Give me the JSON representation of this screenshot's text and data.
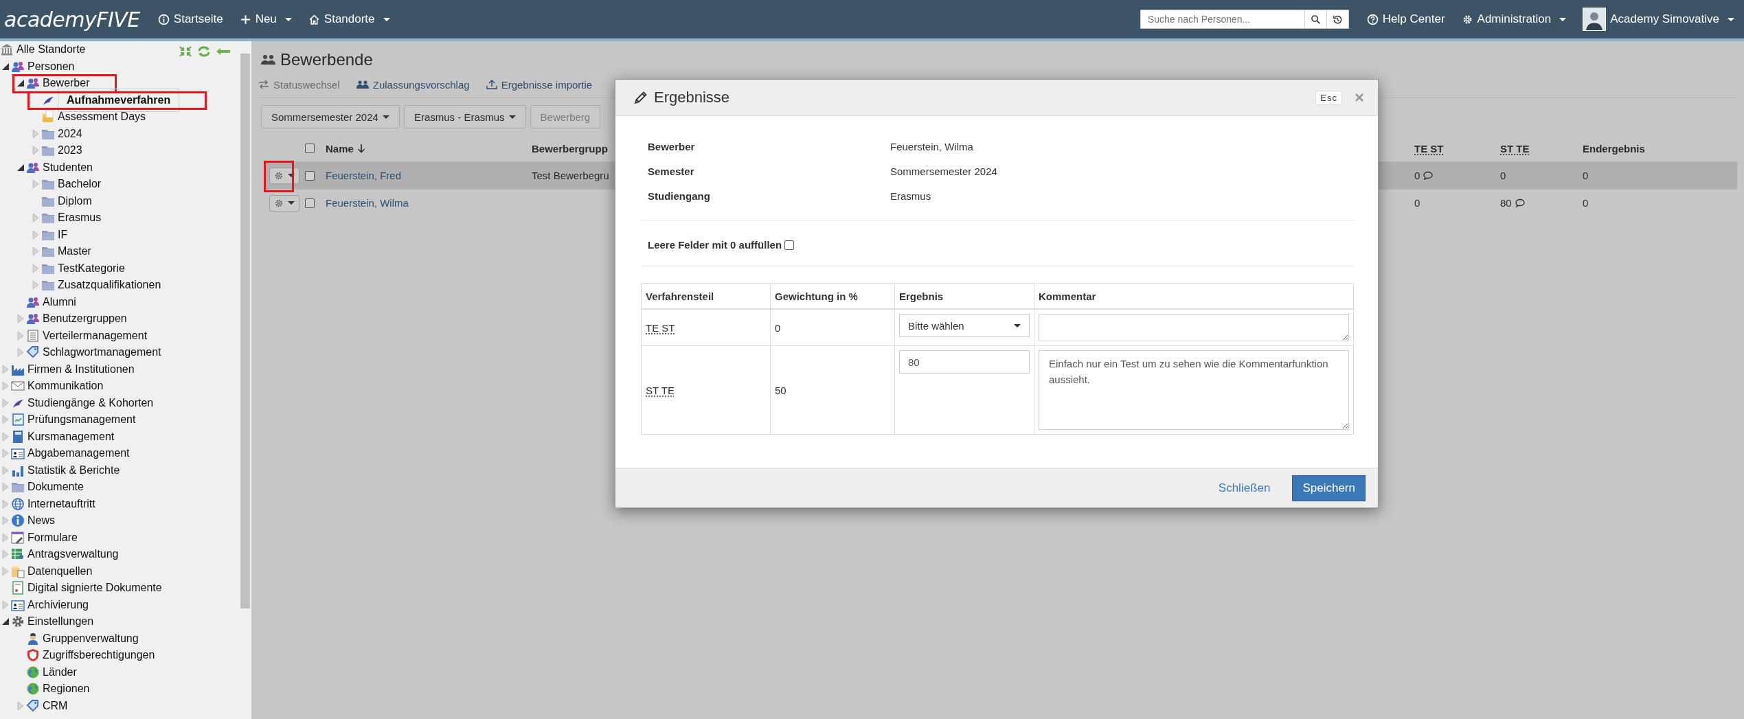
{
  "topbar": {
    "logo": "academyFIVE",
    "nav": [
      {
        "label": "Startseite",
        "kind": "link"
      },
      {
        "label": "Neu",
        "kind": "dropdown"
      },
      {
        "label": "Standorte",
        "kind": "dropdown"
      }
    ],
    "search": {
      "placeholder": "Suche nach Personen..."
    },
    "links": [
      {
        "label": "Help Center",
        "kind": "link"
      },
      {
        "label": "Administration",
        "kind": "dropdown"
      }
    ],
    "user": "Academy Simovative"
  },
  "sidebar": {
    "root": "Alle Standorte",
    "tree": [
      {
        "label": "Personen",
        "kind": "people",
        "expanded": true,
        "selected": false,
        "children": [
          {
            "label": "Bewerber",
            "kind": "people",
            "expanded": true,
            "selected": false,
            "annotated": true,
            "children": [
              {
                "label": "Aufnahmeverfahren",
                "kind": "cap",
                "selected": true,
                "annotated": true
              },
              {
                "label": "Assessment Days",
                "kind": "folder-open",
                "selected": false
              },
              {
                "label": "2024",
                "kind": "folder",
                "expanded": false,
                "selected": false
              },
              {
                "label": "2023",
                "kind": "folder",
                "expanded": false,
                "selected": false
              }
            ]
          },
          {
            "label": "Studenten",
            "kind": "people",
            "expanded": true,
            "selected": false,
            "children": [
              {
                "label": "Bachelor",
                "kind": "folder",
                "expanded": false,
                "selected": false
              },
              {
                "label": "Diplom",
                "kind": "folder",
                "selected": false
              },
              {
                "label": "Erasmus",
                "kind": "folder",
                "expanded": false,
                "selected": false
              },
              {
                "label": "IF",
                "kind": "folder",
                "expanded": false,
                "selected": false
              },
              {
                "label": "Master",
                "kind": "folder",
                "expanded": false,
                "selected": false
              },
              {
                "label": "TestKategorie",
                "kind": "folder",
                "expanded": false,
                "selected": false
              },
              {
                "label": "Zusatzqualifikationen",
                "kind": "folder",
                "expanded": false,
                "selected": false
              }
            ]
          },
          {
            "label": "Alumni",
            "kind": "people",
            "selected": false
          },
          {
            "label": "Benutzergruppen",
            "kind": "people",
            "expanded": false,
            "selected": false
          },
          {
            "label": "Verteilermanagement",
            "kind": "list",
            "expanded": false,
            "selected": false
          },
          {
            "label": "Schlagwortmanagement",
            "kind": "tag",
            "expanded": false,
            "selected": false
          }
        ]
      },
      {
        "label": "Firmen & Institutionen",
        "kind": "factory",
        "expanded": false,
        "selected": false
      },
      {
        "label": "Kommunikation",
        "kind": "mail",
        "expanded": false,
        "selected": false
      },
      {
        "label": "Studiengänge & Kohorten",
        "kind": "cap",
        "expanded": false,
        "selected": false
      },
      {
        "label": "Prüfungsmanagement",
        "kind": "notebook",
        "expanded": false,
        "selected": false
      },
      {
        "label": "Kursmanagement",
        "kind": "book",
        "expanded": false,
        "selected": false
      },
      {
        "label": "Abgabemanagement",
        "kind": "idcard",
        "expanded": false,
        "selected": false
      },
      {
        "label": "Statistik & Berichte",
        "kind": "chart",
        "expanded": false,
        "selected": false
      },
      {
        "label": "Dokumente",
        "kind": "folder",
        "expanded": false,
        "selected": false
      },
      {
        "label": "Internetauftritt",
        "kind": "globe",
        "expanded": false,
        "selected": false
      },
      {
        "label": "News",
        "kind": "info",
        "expanded": false,
        "selected": false
      },
      {
        "label": "Formulare",
        "kind": "form",
        "expanded": false,
        "selected": false
      },
      {
        "label": "Antragsverwaltung",
        "kind": "sheet",
        "expanded": false,
        "selected": false
      },
      {
        "label": "Datenquellen",
        "kind": "database",
        "expanded": false,
        "selected": false
      },
      {
        "label": "Digital signierte Dokumente",
        "kind": "certificate",
        "selected": false
      },
      {
        "label": "Archivierung",
        "kind": "idcard",
        "expanded": false,
        "selected": false
      },
      {
        "label": "Einstellungen",
        "kind": "gear",
        "expanded": true,
        "selected": false,
        "children": [
          {
            "label": "Gruppenverwaltung",
            "kind": "user",
            "selected": false
          },
          {
            "label": "Zugriffsberechtigungen",
            "kind": "shield",
            "selected": false
          },
          {
            "label": "Länder",
            "kind": "earth",
            "selected": false
          },
          {
            "label": "Regionen",
            "kind": "earth",
            "selected": false
          },
          {
            "label": "CRM",
            "kind": "tag",
            "expanded": false,
            "selected": false
          }
        ]
      }
    ]
  },
  "page": {
    "title": "Bewerbende",
    "actions": [
      {
        "label": "Statuswechsel",
        "disabled": true
      },
      {
        "label": "Zulassungsvorschlag",
        "disabled": false
      },
      {
        "label": "Ergebnisse importie",
        "disabled": false
      }
    ],
    "filters": [
      {
        "label": "Sommersemester 2024",
        "kind": "dropdown"
      },
      {
        "label": "Erasmus - Erasmus",
        "kind": "dropdown"
      },
      {
        "label": "Bewerberg",
        "kind": "partial"
      }
    ],
    "table": {
      "columns": [
        "Name",
        "Bewerbergrupp",
        "TE ST",
        "ST TE",
        "Endergebnis"
      ],
      "select_all": false,
      "rows": [
        {
          "name": "Feuerstein, Fred",
          "group": "Test Bewerbegru",
          "te_st": "0",
          "te_st_comment": true,
          "st_te": "0",
          "st_te_comment": false,
          "final": "0",
          "checked": false,
          "highlighted": true,
          "annotated": true
        },
        {
          "name": "Feuerstein, Wilma",
          "te_st": "0",
          "te_st_comment": false,
          "st_te": "80",
          "st_te_comment": true,
          "final": "0",
          "checked": false,
          "highlighted": false,
          "annotated": false
        }
      ]
    }
  },
  "modal": {
    "title": "Ergebnisse",
    "esc": "Esc",
    "info": [
      {
        "label": "Bewerber",
        "value": "Feuerstein, Wilma"
      },
      {
        "label": "Semester",
        "value": "Sommersemester 2024"
      },
      {
        "label": "Studiengang",
        "value": "Erasmus"
      }
    ],
    "fill_zero": {
      "label": "Leere Felder mit 0 auffüllen",
      "checked": false
    },
    "columns": [
      "Verfahrensteil",
      "Gewichtung in %",
      "Ergebnis",
      "Kommentar"
    ],
    "rows": [
      {
        "part": "TE ST",
        "weight": "0",
        "result": {
          "kind": "select",
          "value": "Bitte wählen"
        }
      },
      {
        "part": "ST TE",
        "weight": "50",
        "result": {
          "kind": "input",
          "value": "80"
        },
        "comment": "Einfach nur ein Test um zu sehen wie die Kommentarfunktion aussieht."
      }
    ],
    "buttons": [
      {
        "label": "Schließen",
        "kind": "link"
      },
      {
        "label": "Speichern",
        "kind": "primary"
      }
    ]
  }
}
